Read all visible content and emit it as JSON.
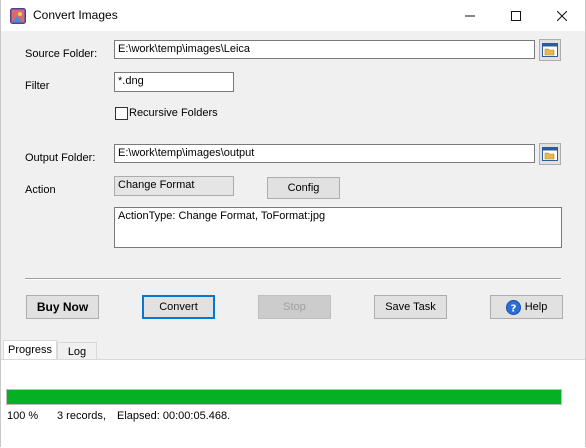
{
  "window": {
    "title": "Convert Images",
    "minimize_glyph": "—",
    "maximize_glyph": "☐",
    "close_glyph": "✕"
  },
  "form": {
    "source_folder_label": "Source Folder:",
    "source_folder_value": "E:\\work\\temp\\images\\Leica",
    "filter_label": "Filter",
    "filter_value": "*.dng",
    "recursive_label": "Recursive Folders",
    "recursive_checked": false,
    "output_folder_label": "Output Folder:",
    "output_folder_value": "E:\\work\\temp\\images\\output",
    "action_label": "Action",
    "action_value": "Change Format",
    "config_label": "Config",
    "action_details": "ActionType: Change Format, ToFormat:jpg"
  },
  "buttons": {
    "buy_now": "Buy Now",
    "convert": "Convert",
    "stop": "Stop",
    "save_task": "Save Task",
    "help": "Help"
  },
  "tabs": [
    {
      "label": "Progress",
      "active": true
    },
    {
      "label": "Log",
      "active": false
    }
  ],
  "progress": {
    "percent_value": 1.0,
    "percent_text": "100 %",
    "records_text": "3 records,",
    "elapsed_text": "Elapsed: 00:00:05.468.",
    "fill_color": "#06b025"
  },
  "icons": {
    "app": "app-icon",
    "folder": "folder-icon",
    "help": "help-icon",
    "dropdown": "chevron-down-icon"
  }
}
